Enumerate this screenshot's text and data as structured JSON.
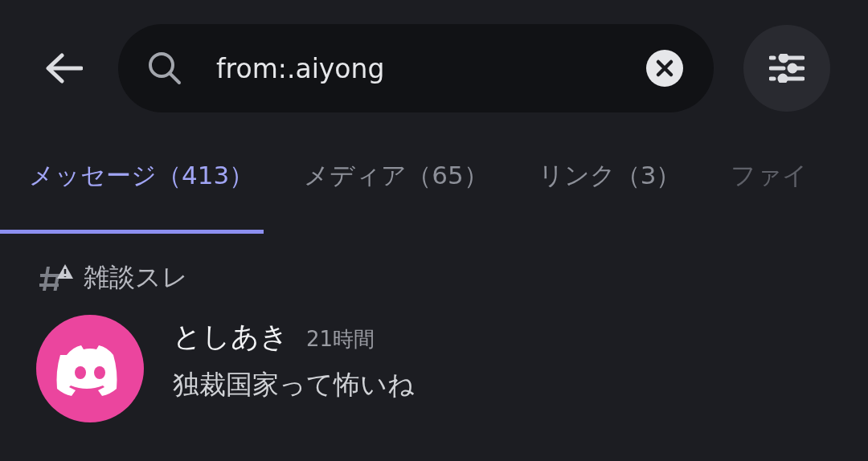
{
  "search": {
    "value": "from:.aiyong"
  },
  "tabs": [
    {
      "label": "メッセージ（413）",
      "selected": true
    },
    {
      "label": "メディア（65）",
      "selected": false
    },
    {
      "label": "リンク（3）",
      "selected": false
    },
    {
      "label": "ファイ",
      "selected": false
    }
  ],
  "results": [
    {
      "channel": "雑談スレ",
      "messages": [
        {
          "author": "としあき",
          "time": "21時間",
          "text": "独裁国家って怖いね"
        }
      ]
    }
  ]
}
